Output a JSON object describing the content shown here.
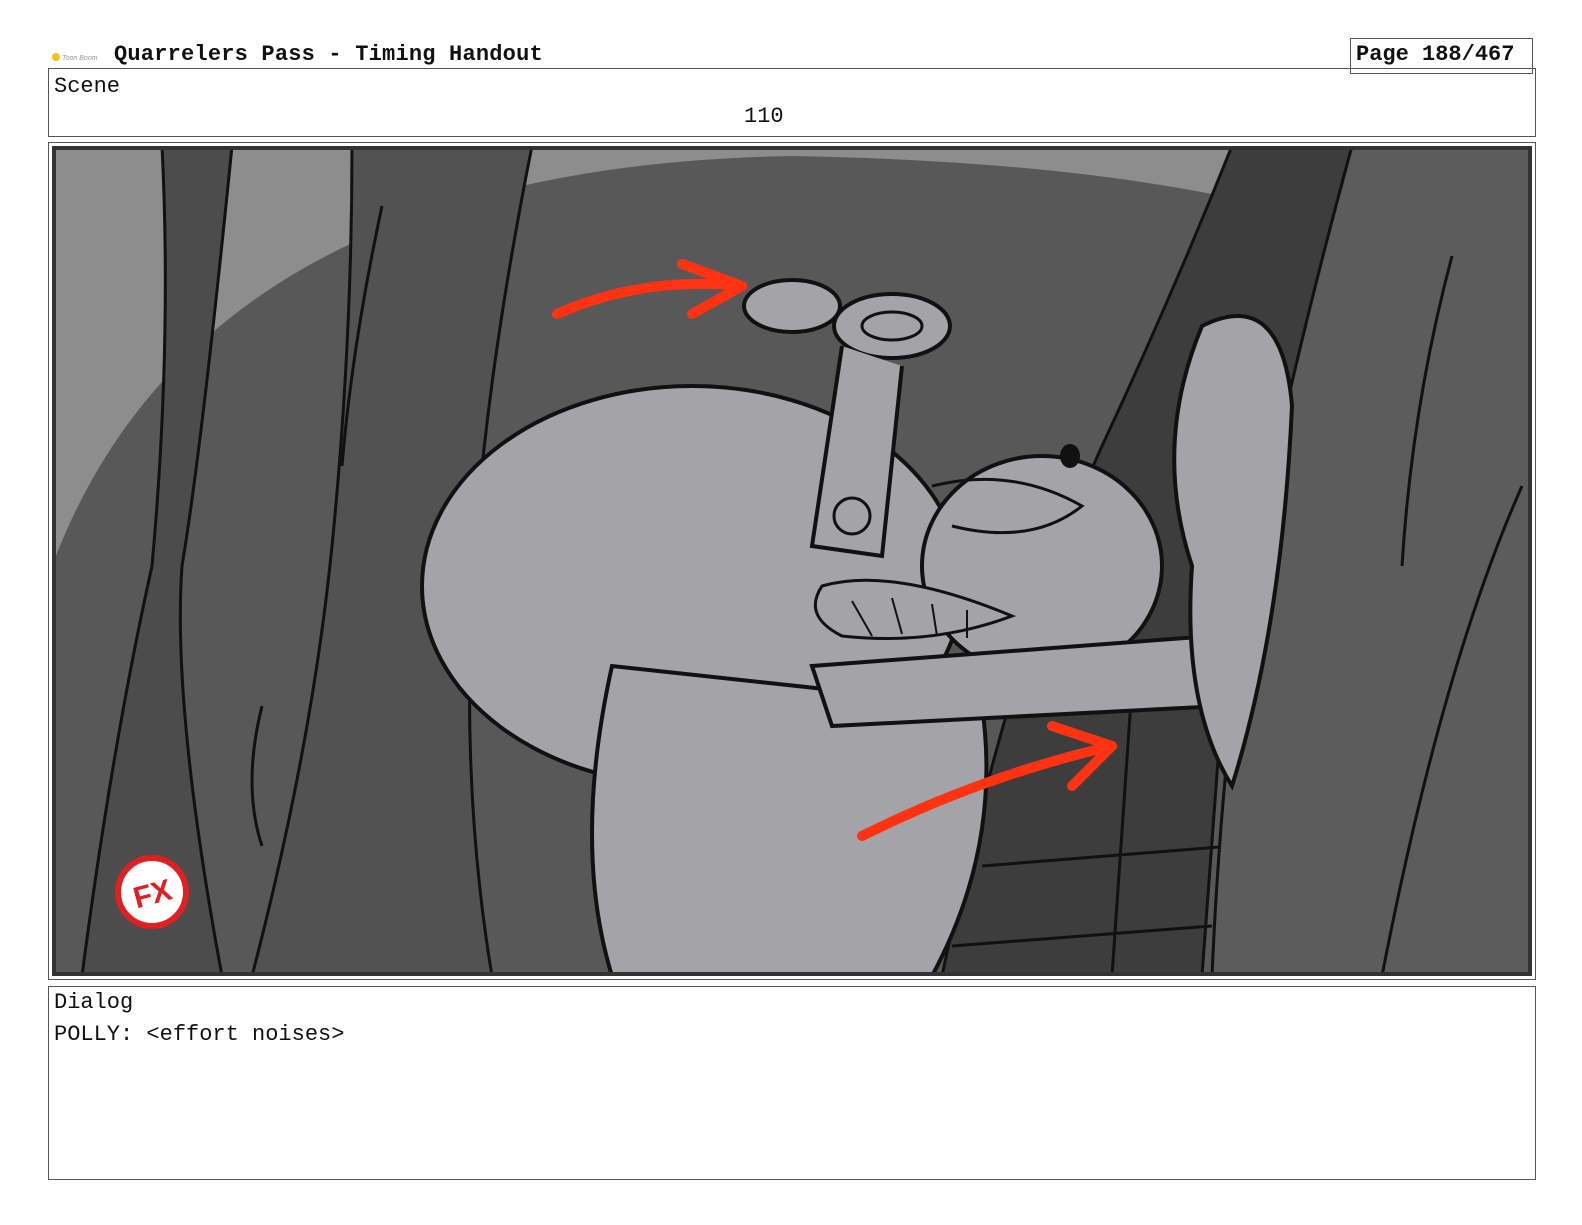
{
  "header": {
    "logo_text": "Toon Boom",
    "title": "Quarrelers Pass - Timing Handout",
    "page": "Page 188/467"
  },
  "scene": {
    "label": "Scene",
    "number": "110"
  },
  "panel": {
    "fx_badge_text": "FX",
    "colors": {
      "arrow": "#ff3311",
      "badge": "#e02020",
      "sketch_gray": "#a3a3a8",
      "tree_gray": "#585858"
    }
  },
  "dialog": {
    "label": "Dialog",
    "lines": [
      "POLLY: <effort noises>"
    ]
  }
}
